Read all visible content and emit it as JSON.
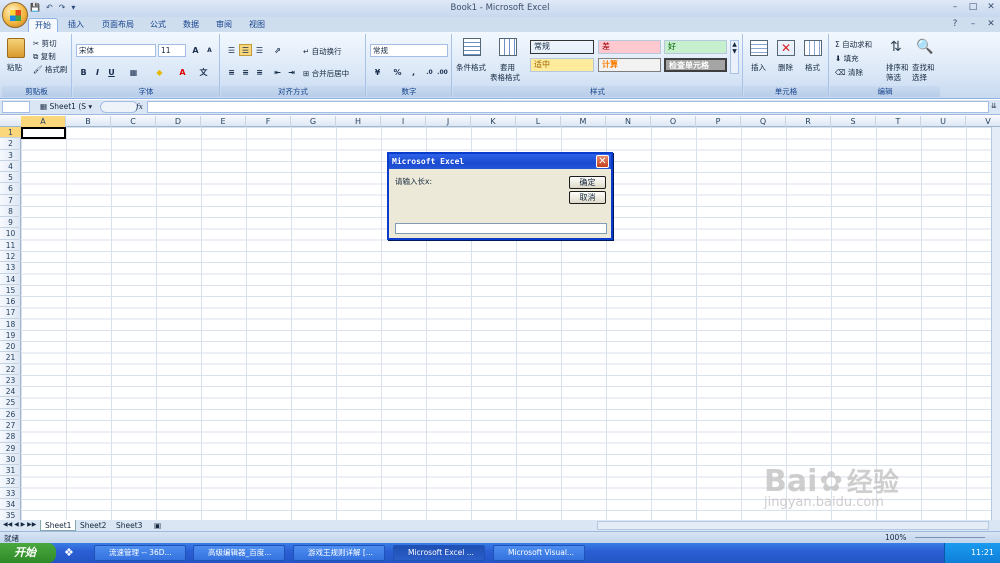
{
  "window": {
    "title": "Book1 - Microsoft Excel"
  },
  "tabs": [
    "开始",
    "插入",
    "页面布局",
    "公式",
    "数据",
    "审阅",
    "视图"
  ],
  "clipboard": {
    "paste": "粘贴",
    "cut": "剪切",
    "copy": "复制",
    "format_painter": "格式刷",
    "label": "剪贴板"
  },
  "font": {
    "name": "宋体",
    "size": "11",
    "label": "字体",
    "bold": "B",
    "italic": "I",
    "underline": "U",
    "grow": "A",
    "shrink": "A"
  },
  "alignment": {
    "wrap": "自动换行",
    "merge": "合并后居中",
    "label": "对齐方式"
  },
  "number": {
    "format": "常规",
    "percent": "%",
    "comma": ",",
    "label": "数字"
  },
  "styles": {
    "conditional": "条件格式",
    "table": "套用",
    "table2": "表格格式",
    "cells": [
      {
        "text": "常规",
        "bg": "#ffffff",
        "fg": "#000000"
      },
      {
        "text": "差",
        "bg": "#ffc7ce",
        "fg": "#9c0006"
      },
      {
        "text": "好",
        "bg": "#c6efce",
        "fg": "#006100"
      },
      {
        "text": "适中",
        "bg": "#ffeb9c",
        "fg": "#9c6500"
      },
      {
        "text": "计算",
        "bg": "#f2f2f2",
        "fg": "#fa7d00"
      },
      {
        "text": "检查单元格",
        "bg": "#a5a5a5",
        "fg": "#ffffff"
      }
    ],
    "label": "样式"
  },
  "cells_group": {
    "insert": "插入",
    "delete": "删除",
    "format": "格式",
    "label": "单元格"
  },
  "editing": {
    "autosum": "自动求和",
    "fill": "填充",
    "clear": "清除",
    "sort": "排序和",
    "sort2": "筛选",
    "find": "查找和",
    "find2": "选择",
    "label": "编辑"
  },
  "formula_bar": {
    "name_box": "",
    "fx": "fx",
    "sheet_ref": "Sheet1 (S"
  },
  "columns": [
    "A",
    "B",
    "C",
    "D",
    "E",
    "F",
    "G",
    "H",
    "I",
    "J",
    "K",
    "L",
    "M",
    "N",
    "O",
    "P",
    "Q",
    "R",
    "S",
    "T",
    "U",
    "V"
  ],
  "rows": [
    "1",
    "2",
    "3",
    "4",
    "5",
    "6",
    "7",
    "8",
    "9",
    "10",
    "11",
    "12",
    "13",
    "14",
    "15",
    "16",
    "17",
    "18",
    "19",
    "20",
    "21",
    "22",
    "23",
    "24",
    "25",
    "26",
    "27",
    "28",
    "29",
    "30",
    "31",
    "32",
    "33",
    "34",
    "35"
  ],
  "sheets": [
    "Sheet1",
    "Sheet2",
    "Sheet3"
  ],
  "status": {
    "ready": "就绪",
    "zoom": "100%"
  },
  "dialog": {
    "title": "Microsoft Excel",
    "prompt": "请输入长x:",
    "ok": "确定",
    "cancel": "取消",
    "input_value": ""
  },
  "taskbar": {
    "start": "开始",
    "items": [
      "流速管理 -- 36D...",
      "高级编辑器_百度...",
      "游戏王规则详解 [...",
      "Microsoft Excel ...",
      "Microsoft Visual..."
    ],
    "clock": "11:21"
  },
  "watermark": {
    "line1": "Bai",
    "line2": "经验",
    "url": "jingyan.baidu.com"
  }
}
